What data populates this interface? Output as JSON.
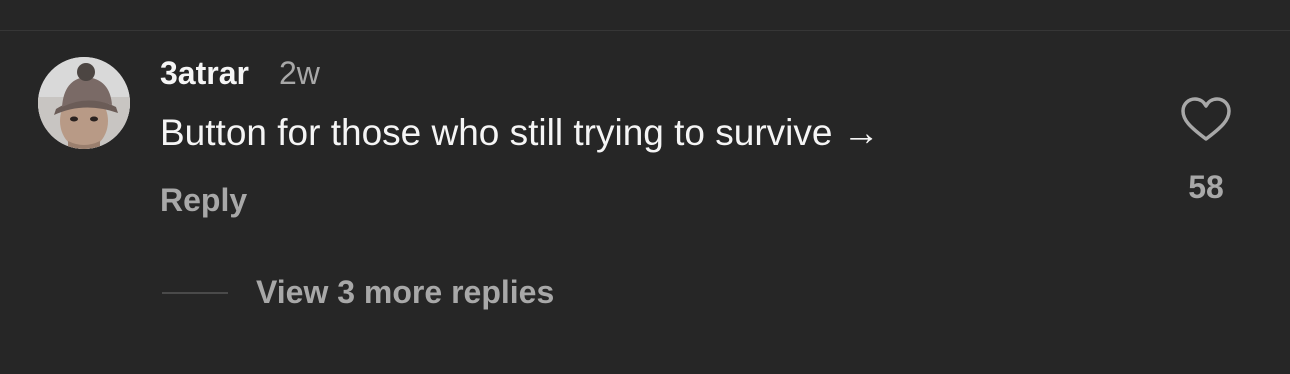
{
  "comment": {
    "avatar_icon": "user-avatar-photo",
    "username": "3atrar",
    "timestamp": "2w",
    "text": "Button for those who still trying to survive →",
    "reply_label": "Reply",
    "like_icon": "heart-outline-icon",
    "like_count": "58"
  },
  "replies": {
    "view_more_label": "View 3 more replies"
  },
  "colors": {
    "background": "#262626",
    "primary_text": "#f5f5f5",
    "secondary_text": "#a8a8a8"
  }
}
